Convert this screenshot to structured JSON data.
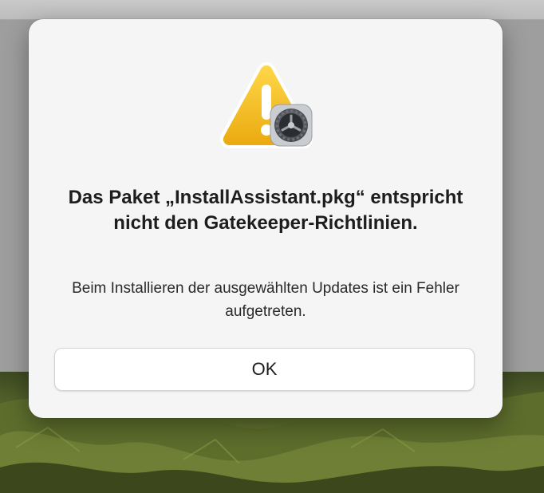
{
  "dialog": {
    "title": "Das Paket „InstallAssistant.pkg“ entspricht nicht den Gatekeeper-Richtlinien.",
    "message": "Beim Installieren der ausgewählten Updates ist ein Fehler aufgetreten.",
    "ok_label": "OK",
    "icons": {
      "warning": "warning-triangle-icon",
      "badge": "system-preferences-gear-icon"
    }
  },
  "colors": {
    "warning_fill": "#f2bd1f",
    "dialog_background": "#f5f5f5",
    "text": "#1d1d1d"
  }
}
